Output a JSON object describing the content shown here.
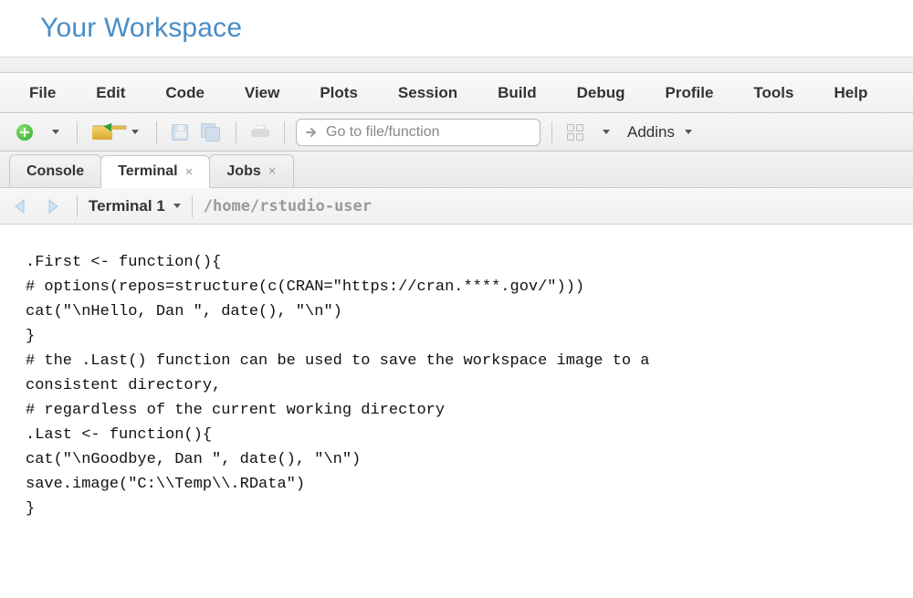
{
  "header": {
    "title": "Your Workspace"
  },
  "menu": {
    "items": [
      "File",
      "Edit",
      "Code",
      "View",
      "Plots",
      "Session",
      "Build",
      "Debug",
      "Profile",
      "Tools",
      "Help"
    ]
  },
  "toolbar": {
    "goto_placeholder": "Go to file/function",
    "addins_label": "Addins"
  },
  "tabs": {
    "console": "Console",
    "terminal": "Terminal",
    "jobs": "Jobs"
  },
  "terminal": {
    "name": "Terminal 1",
    "path": "/home/rstudio-user",
    "content": ".First <- function(){\n# options(repos=structure(c(CRAN=\"https://cran.****.gov/\")))\ncat(\"\\nHello, Dan \", date(), \"\\n\")\n}\n# the .Last() function can be used to save the workspace image to a\nconsistent directory,\n# regardless of the current working directory\n.Last <- function(){\ncat(\"\\nGoodbye, Dan \", date(), \"\\n\")\nsave.image(\"C:\\\\Temp\\\\.RData\")\n}"
  }
}
